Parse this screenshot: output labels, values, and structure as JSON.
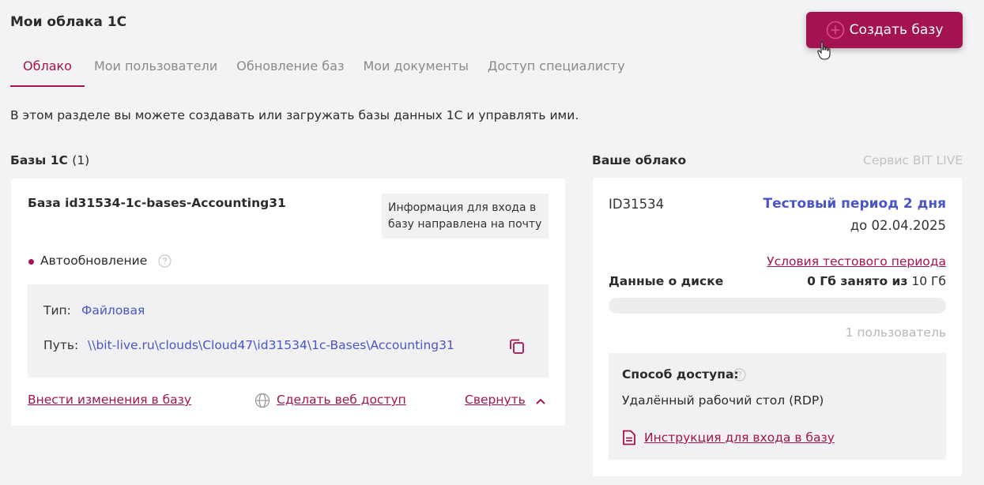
{
  "header": {
    "title": "Мои облака 1С",
    "create_button": "Создать базу"
  },
  "tabs": [
    {
      "label": "Облако",
      "active": true
    },
    {
      "label": "Мои пользователи",
      "active": false
    },
    {
      "label": "Обновление баз",
      "active": false
    },
    {
      "label": "Мои документы",
      "active": false
    },
    {
      "label": "Доступ специалисту",
      "active": false
    }
  ],
  "intro": "В этом разделе вы можете создавать или загружать базы данных 1С и управлять ими.",
  "bases": {
    "heading": "Базы 1С",
    "count": "(1)",
    "item": {
      "name": "База id31534-1c-bases-Accounting31",
      "note": "Информация для входа в базу направлена на почту",
      "auto_update": "Автообновление",
      "type_label": "Тип:",
      "type_value": "Файловая",
      "path_label": "Путь:",
      "path_value": "\\\\bit-live.ru\\clouds\\Cloud47\\id31534\\1c-Bases\\Accounting31",
      "edit_link": "Внести изменения в базу",
      "web_link": "Сделать веб доступ",
      "collapse_link": "Свернуть"
    }
  },
  "cloud": {
    "heading": "Ваше облако",
    "service": "Сервис BIT LIVE",
    "id": "ID31534",
    "trial": "Тестовый период 2 дня",
    "until": "до 02.04.2025",
    "trial_terms": "Условия тестового периода",
    "disk_label": "Данные о диске",
    "disk_used": "0 Гб занято из",
    "disk_total": "10 Гб",
    "disk_used_fraction": 0,
    "users": "1 пользователь",
    "access_title": "Способ доступа:",
    "access_value": "Удалённый рабочий стол (RDP)",
    "instruction": "Инструкция для входа в базу"
  },
  "colors": {
    "accent": "#a3134f",
    "link_blue": "#4a55c8"
  }
}
